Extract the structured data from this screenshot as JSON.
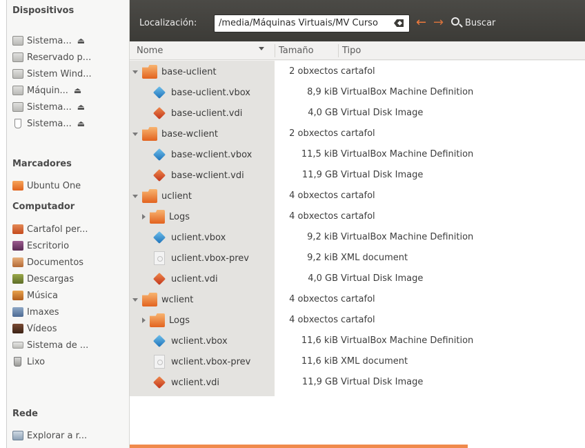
{
  "sidebar": {
    "headings": {
      "devices": "Dispositivos",
      "bookmarks": "Marcadores",
      "computer": "Computador",
      "network": "Rede"
    },
    "devices": [
      {
        "label": "Sistema...",
        "icon": "drive-icon",
        "eject": true
      },
      {
        "label": "Reservado p...",
        "icon": "drive-icon",
        "eject": false
      },
      {
        "label": "Sistem Wind...",
        "icon": "drive-icon",
        "eject": false
      },
      {
        "label": "Máquin...",
        "icon": "drive-icon",
        "eject": true
      },
      {
        "label": "Sistema...",
        "icon": "drive-icon",
        "eject": true
      },
      {
        "label": "Sistema...",
        "icon": "usb-icon",
        "eject": true
      }
    ],
    "bookmarks": [
      {
        "label": "Ubuntu One",
        "icon": "folder-icon"
      }
    ],
    "computer": [
      {
        "label": "Cartafol per...",
        "icon": "home-folder-icon"
      },
      {
        "label": "Escritorio",
        "icon": "desktop-icon"
      },
      {
        "label": "Documentos",
        "icon": "documents-icon"
      },
      {
        "label": "Descargas",
        "icon": "downloads-icon"
      },
      {
        "label": "Música",
        "icon": "music-icon"
      },
      {
        "label": "Imaxes",
        "icon": "pictures-icon"
      },
      {
        "label": "Vídeos",
        "icon": "videos-icon"
      },
      {
        "label": "Sistema de ...",
        "icon": "filesystem-icon"
      },
      {
        "label": "Lixo",
        "icon": "trash-icon"
      }
    ],
    "network": [
      {
        "label": "Explorar a r...",
        "icon": "network-icon"
      }
    ],
    "eject_glyph": "⏏"
  },
  "location": {
    "label": "Localización:",
    "path": "/media/Máquinas Virtuais/MV Curso",
    "back_glyph": "←",
    "forward_glyph": "→",
    "search_label": "Buscar"
  },
  "columns": {
    "name": "Nome",
    "size": "Tamaño",
    "type": "Tipo"
  },
  "rows": [
    {
      "name": "base-uclient",
      "size": "2 obxectos",
      "type": "cartafol",
      "kind": "folder",
      "level": 0,
      "expander": "down"
    },
    {
      "name": "base-uclient.vbox",
      "size": "8,9 kiB",
      "type": "VirtualBox Machine Definition",
      "kind": "vbox",
      "level": 1,
      "expander": ""
    },
    {
      "name": "base-uclient.vdi",
      "size": "4,0 GB",
      "type": "Virtual Disk Image",
      "kind": "vdi",
      "level": 1,
      "expander": ""
    },
    {
      "name": "base-wclient",
      "size": "2 obxectos",
      "type": "cartafol",
      "kind": "folder",
      "level": 0,
      "expander": "down"
    },
    {
      "name": "base-wclient.vbox",
      "size": "11,5 kiB",
      "type": "VirtualBox Machine Definition",
      "kind": "vbox",
      "level": 1,
      "expander": ""
    },
    {
      "name": "base-wclient.vdi",
      "size": "11,9 GB",
      "type": "Virtual Disk Image",
      "kind": "vdi",
      "level": 1,
      "expander": ""
    },
    {
      "name": "uclient",
      "size": "4 obxectos",
      "type": "cartafol",
      "kind": "folder",
      "level": 0,
      "expander": "down"
    },
    {
      "name": "Logs",
      "size": "4 obxectos",
      "type": "cartafol",
      "kind": "folder",
      "level": 1,
      "expander": "right"
    },
    {
      "name": "uclient.vbox",
      "size": "9,2 kiB",
      "type": "VirtualBox Machine Definition",
      "kind": "vbox",
      "level": 1,
      "expander": ""
    },
    {
      "name": "uclient.vbox-prev",
      "size": "9,2 kiB",
      "type": "XML document",
      "kind": "xml",
      "level": 1,
      "expander": ""
    },
    {
      "name": "uclient.vdi",
      "size": "4,0 GB",
      "type": "Virtual Disk Image",
      "kind": "vdi",
      "level": 1,
      "expander": ""
    },
    {
      "name": "wclient",
      "size": "4 obxectos",
      "type": "cartafol",
      "kind": "folder",
      "level": 0,
      "expander": "down"
    },
    {
      "name": "Logs",
      "size": "4 obxectos",
      "type": "cartafol",
      "kind": "folder",
      "level": 1,
      "expander": "right"
    },
    {
      "name": "wclient.vbox",
      "size": "11,6 kiB",
      "type": "VirtualBox Machine Definition",
      "kind": "vbox",
      "level": 1,
      "expander": ""
    },
    {
      "name": "wclient.vbox-prev",
      "size": "11,6 kiB",
      "type": "XML document",
      "kind": "xml",
      "level": 1,
      "expander": ""
    },
    {
      "name": "wclient.vdi",
      "size": "11,9 GB",
      "type": "Virtual Disk Image",
      "kind": "vdi",
      "level": 1,
      "expander": ""
    }
  ],
  "colors": {
    "toolbar_bg": "#3c3b37",
    "accent": "#f07a3c",
    "name_column_bg": "#e4e3e0"
  }
}
